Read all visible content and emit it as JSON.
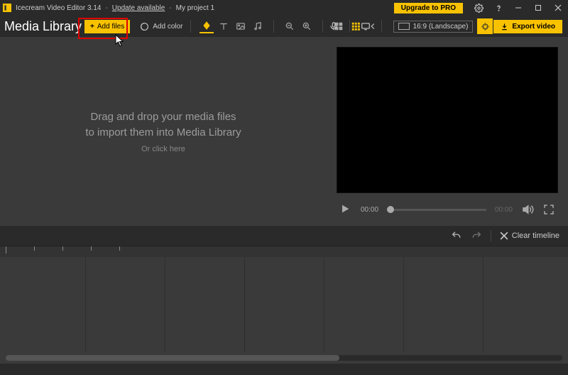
{
  "titlebar": {
    "app_name": "Icecream Video Editor 3.14",
    "update_link": "Update available",
    "project_name": "My project 1",
    "upgrade_label": "Upgrade to PRO"
  },
  "toolbar": {
    "media_library_title": "Media Library",
    "add_files_label": "Add files",
    "add_color_label": "Add color",
    "aspect_label": "16:9 (Landscape)",
    "export_label": "Export video"
  },
  "library": {
    "drop_line1": "Drag and drop your media files",
    "drop_line2": "to import them into Media Library",
    "click_hint": "Or click here"
  },
  "player": {
    "time_current": "00:00",
    "time_total": "00:00"
  },
  "timeline_header": {
    "clear_label": "Clear timeline"
  }
}
